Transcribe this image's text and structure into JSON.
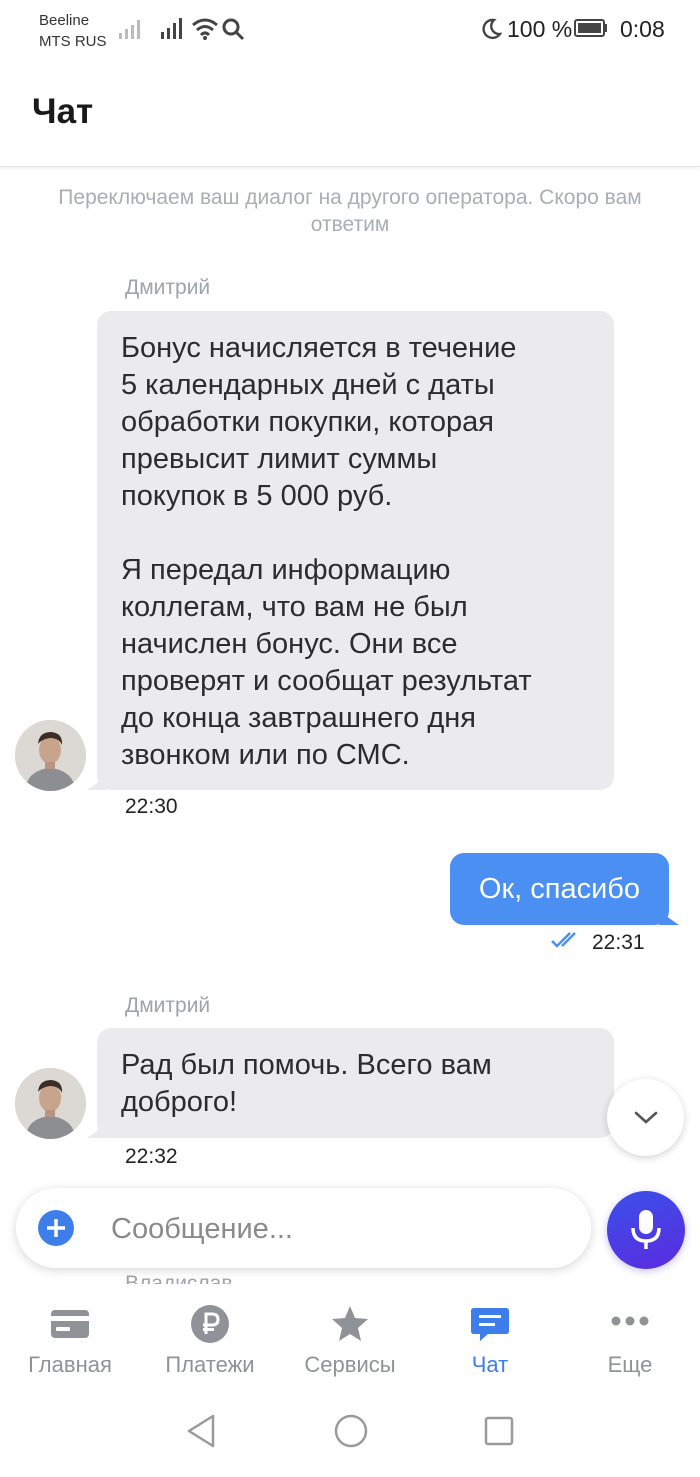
{
  "status_bar": {
    "carrier_1": "Beeline",
    "carrier_2": "MTS RUS",
    "battery_percent": "100 %",
    "time": "0:08",
    "icons": [
      "signal-icon",
      "signal-icon",
      "wifi-icon",
      "search-icon",
      "moon-icon",
      "battery-icon"
    ]
  },
  "header": {
    "title": "Чат"
  },
  "chat": {
    "system_note": "Переключаем ваш диалог на другого оператора. Скоро вам ответим",
    "messages": [
      {
        "direction": "incoming",
        "sender": "Дмитрий",
        "paragraphs": [
          "Бонус начисляется в течение\n5 календарных дней с даты\nобработки покупки, которая\nпревысит лимит суммы\nпокупок в 5 000 руб.",
          "Я передал информацию\nколлегам, что вам не был\nначислен бонус. Они все\nпроверят и сообщат результат\nдо конца завтрашнего дня\nзвонком или по СМС."
        ],
        "time": "22:30"
      },
      {
        "direction": "outgoing",
        "text": "Ок, спасибо",
        "time": "22:31",
        "status": "read"
      },
      {
        "direction": "incoming",
        "sender": "Дмитрий",
        "paragraphs": [
          "Рад был помочь. Всего вам\nдоброго!"
        ],
        "time": "22:32"
      }
    ],
    "partial_sender": "Владислав"
  },
  "composer": {
    "placeholder": "Сообщение..."
  },
  "bottom_nav": {
    "items": [
      {
        "label": "Главная",
        "icon": "card-icon"
      },
      {
        "label": "Платежи",
        "icon": "ruble-icon"
      },
      {
        "label": "Сервисы",
        "icon": "star-icon"
      },
      {
        "label": "Чат",
        "icon": "chat-icon",
        "active": true
      },
      {
        "label": "Еще",
        "icon": "more-icon"
      }
    ]
  },
  "colors": {
    "accent": "#3d7eeb",
    "outgoing_bubble": "#4b8ff2",
    "incoming_bubble": "#ebebee",
    "mic_button": "#4a3de6"
  }
}
